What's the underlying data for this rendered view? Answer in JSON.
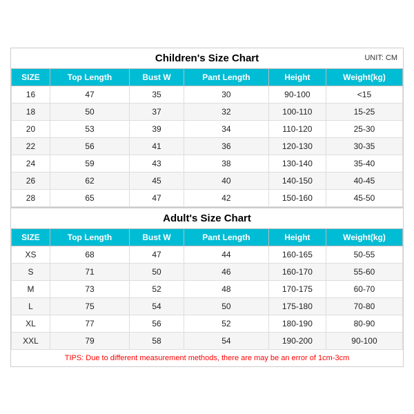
{
  "children_title": "Children's Size Chart",
  "adult_title": "Adult's Size Chart",
  "unit": "UNIT: CM",
  "tips": "TIPS: Due to different measurement methods, there are may be an error of 1cm-3cm",
  "headers": [
    "SIZE",
    "Top Length",
    "Bust W",
    "Pant Length",
    "Height",
    "Weight(kg)"
  ],
  "children_rows": [
    [
      "16",
      "47",
      "35",
      "30",
      "90-100",
      "<15"
    ],
    [
      "18",
      "50",
      "37",
      "32",
      "100-110",
      "15-25"
    ],
    [
      "20",
      "53",
      "39",
      "34",
      "110-120",
      "25-30"
    ],
    [
      "22",
      "56",
      "41",
      "36",
      "120-130",
      "30-35"
    ],
    [
      "24",
      "59",
      "43",
      "38",
      "130-140",
      "35-40"
    ],
    [
      "26",
      "62",
      "45",
      "40",
      "140-150",
      "40-45"
    ],
    [
      "28",
      "65",
      "47",
      "42",
      "150-160",
      "45-50"
    ]
  ],
  "adult_rows": [
    [
      "XS",
      "68",
      "47",
      "44",
      "160-165",
      "50-55"
    ],
    [
      "S",
      "71",
      "50",
      "46",
      "160-170",
      "55-60"
    ],
    [
      "M",
      "73",
      "52",
      "48",
      "170-175",
      "60-70"
    ],
    [
      "L",
      "75",
      "54",
      "50",
      "175-180",
      "70-80"
    ],
    [
      "XL",
      "77",
      "56",
      "52",
      "180-190",
      "80-90"
    ],
    [
      "XXL",
      "79",
      "58",
      "54",
      "190-200",
      "90-100"
    ]
  ]
}
